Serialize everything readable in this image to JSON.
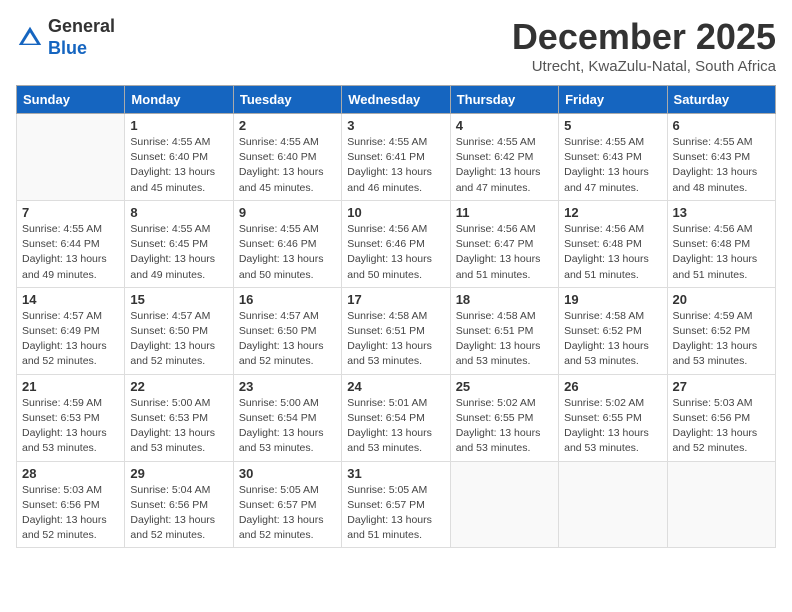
{
  "header": {
    "logo_general": "General",
    "logo_blue": "Blue",
    "title": "December 2025",
    "subtitle": "Utrecht, KwaZulu-Natal, South Africa"
  },
  "columns": [
    "Sunday",
    "Monday",
    "Tuesday",
    "Wednesday",
    "Thursday",
    "Friday",
    "Saturday"
  ],
  "weeks": [
    [
      {
        "day": "",
        "info": ""
      },
      {
        "day": "1",
        "info": "Sunrise: 4:55 AM\nSunset: 6:40 PM\nDaylight: 13 hours\nand 45 minutes."
      },
      {
        "day": "2",
        "info": "Sunrise: 4:55 AM\nSunset: 6:40 PM\nDaylight: 13 hours\nand 45 minutes."
      },
      {
        "day": "3",
        "info": "Sunrise: 4:55 AM\nSunset: 6:41 PM\nDaylight: 13 hours\nand 46 minutes."
      },
      {
        "day": "4",
        "info": "Sunrise: 4:55 AM\nSunset: 6:42 PM\nDaylight: 13 hours\nand 47 minutes."
      },
      {
        "day": "5",
        "info": "Sunrise: 4:55 AM\nSunset: 6:43 PM\nDaylight: 13 hours\nand 47 minutes."
      },
      {
        "day": "6",
        "info": "Sunrise: 4:55 AM\nSunset: 6:43 PM\nDaylight: 13 hours\nand 48 minutes."
      }
    ],
    [
      {
        "day": "7",
        "info": "Sunrise: 4:55 AM\nSunset: 6:44 PM\nDaylight: 13 hours\nand 49 minutes."
      },
      {
        "day": "8",
        "info": "Sunrise: 4:55 AM\nSunset: 6:45 PM\nDaylight: 13 hours\nand 49 minutes."
      },
      {
        "day": "9",
        "info": "Sunrise: 4:55 AM\nSunset: 6:46 PM\nDaylight: 13 hours\nand 50 minutes."
      },
      {
        "day": "10",
        "info": "Sunrise: 4:56 AM\nSunset: 6:46 PM\nDaylight: 13 hours\nand 50 minutes."
      },
      {
        "day": "11",
        "info": "Sunrise: 4:56 AM\nSunset: 6:47 PM\nDaylight: 13 hours\nand 51 minutes."
      },
      {
        "day": "12",
        "info": "Sunrise: 4:56 AM\nSunset: 6:48 PM\nDaylight: 13 hours\nand 51 minutes."
      },
      {
        "day": "13",
        "info": "Sunrise: 4:56 AM\nSunset: 6:48 PM\nDaylight: 13 hours\nand 51 minutes."
      }
    ],
    [
      {
        "day": "14",
        "info": "Sunrise: 4:57 AM\nSunset: 6:49 PM\nDaylight: 13 hours\nand 52 minutes."
      },
      {
        "day": "15",
        "info": "Sunrise: 4:57 AM\nSunset: 6:50 PM\nDaylight: 13 hours\nand 52 minutes."
      },
      {
        "day": "16",
        "info": "Sunrise: 4:57 AM\nSunset: 6:50 PM\nDaylight: 13 hours\nand 52 minutes."
      },
      {
        "day": "17",
        "info": "Sunrise: 4:58 AM\nSunset: 6:51 PM\nDaylight: 13 hours\nand 53 minutes."
      },
      {
        "day": "18",
        "info": "Sunrise: 4:58 AM\nSunset: 6:51 PM\nDaylight: 13 hours\nand 53 minutes."
      },
      {
        "day": "19",
        "info": "Sunrise: 4:58 AM\nSunset: 6:52 PM\nDaylight: 13 hours\nand 53 minutes."
      },
      {
        "day": "20",
        "info": "Sunrise: 4:59 AM\nSunset: 6:52 PM\nDaylight: 13 hours\nand 53 minutes."
      }
    ],
    [
      {
        "day": "21",
        "info": "Sunrise: 4:59 AM\nSunset: 6:53 PM\nDaylight: 13 hours\nand 53 minutes."
      },
      {
        "day": "22",
        "info": "Sunrise: 5:00 AM\nSunset: 6:53 PM\nDaylight: 13 hours\nand 53 minutes."
      },
      {
        "day": "23",
        "info": "Sunrise: 5:00 AM\nSunset: 6:54 PM\nDaylight: 13 hours\nand 53 minutes."
      },
      {
        "day": "24",
        "info": "Sunrise: 5:01 AM\nSunset: 6:54 PM\nDaylight: 13 hours\nand 53 minutes."
      },
      {
        "day": "25",
        "info": "Sunrise: 5:02 AM\nSunset: 6:55 PM\nDaylight: 13 hours\nand 53 minutes."
      },
      {
        "day": "26",
        "info": "Sunrise: 5:02 AM\nSunset: 6:55 PM\nDaylight: 13 hours\nand 53 minutes."
      },
      {
        "day": "27",
        "info": "Sunrise: 5:03 AM\nSunset: 6:56 PM\nDaylight: 13 hours\nand 52 minutes."
      }
    ],
    [
      {
        "day": "28",
        "info": "Sunrise: 5:03 AM\nSunset: 6:56 PM\nDaylight: 13 hours\nand 52 minutes."
      },
      {
        "day": "29",
        "info": "Sunrise: 5:04 AM\nSunset: 6:56 PM\nDaylight: 13 hours\nand 52 minutes."
      },
      {
        "day": "30",
        "info": "Sunrise: 5:05 AM\nSunset: 6:57 PM\nDaylight: 13 hours\nand 52 minutes."
      },
      {
        "day": "31",
        "info": "Sunrise: 5:05 AM\nSunset: 6:57 PM\nDaylight: 13 hours\nand 51 minutes."
      },
      {
        "day": "",
        "info": ""
      },
      {
        "day": "",
        "info": ""
      },
      {
        "day": "",
        "info": ""
      }
    ]
  ]
}
